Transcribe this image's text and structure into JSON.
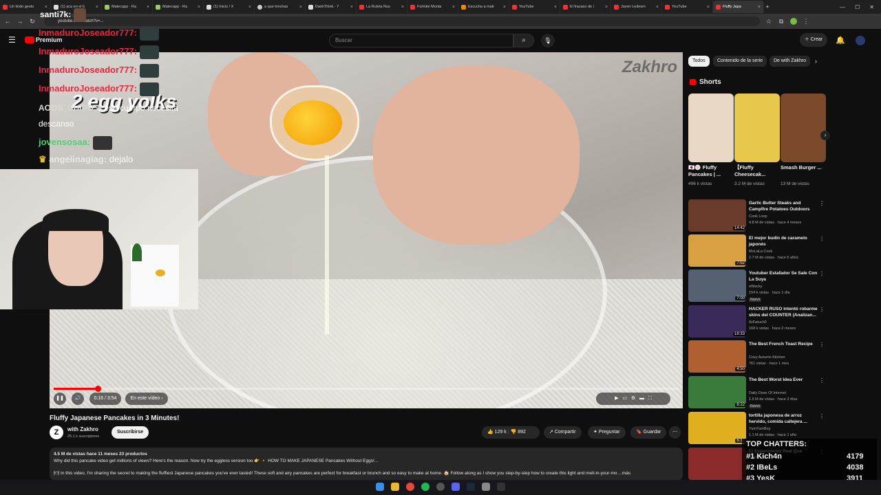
{
  "browser": {
    "tabs": [
      {
        "label": "Un lindo gesto"
      },
      {
        "label": "(1) aca en el b"
      },
      {
        "label": "Matecapp - Ra"
      },
      {
        "label": "Matecapp - Ra"
      },
      {
        "label": "(1) Inicio / X"
      },
      {
        "label": "a que hinchas"
      },
      {
        "label": "DankThink - 7"
      },
      {
        "label": "La Ruleta Rus"
      },
      {
        "label": "Fortnite Monta"
      },
      {
        "label": "Escucha a mati"
      },
      {
        "label": "YouTube"
      },
      {
        "label": "El fracaso de l"
      },
      {
        "label": "Javier Ledesm"
      },
      {
        "label": "YouTube"
      },
      {
        "label": "Fluffy Japa"
      }
    ],
    "url": "youtube.com/watch?v=..."
  },
  "youtube": {
    "premium_label": "Premium",
    "search_placeholder": "Buscar",
    "create_label": "Crear"
  },
  "video": {
    "watermark": "Zakhro",
    "overlay_text": "2 egg yolks",
    "time": "0:16 / 3:54",
    "chapter": "En este vídeo",
    "progress_fraction": 0.07,
    "title": "Fluffy Japanese Pancakes in 3 Minutes!",
    "channel": "with Zakhro",
    "subscribers": "25.1 k suscriptores",
    "subscribe_label": "Suscribirse",
    "likes": "129 k",
    "dislikes": "892",
    "share_label": "Compartir",
    "ask_label": "Preguntar",
    "save_label": "Guardar",
    "views_line": "4.5 M de vistas  hace 11 meses  23 productos",
    "desc_line1": "Why did this pancake video get millions of views? Here's the reason. Now try the eggless version too 👉 🔸 HOW TO MAKE JAPANESE Pancakes Without Eggs!...",
    "desc_line2": "🍽 In this video, I'm sharing the secret to making the fluffiest Japanese pancakes you've ever tasted! These soft and airy pancakes are perfect for breakfast or brunch and so easy to make at home. 🏠 Follow along as I show you step-by-step how to create this light and melt-in-your-mo ...más"
  },
  "chat": [
    {
      "user": "santi7k:",
      "text": ""
    },
    {
      "user": "InmaduroJoseador777:",
      "text": ""
    },
    {
      "user": "InmaduroJoseador777:",
      "text": ""
    },
    {
      "user": "InmaduroJoseador777:",
      "text": ""
    },
    {
      "user": "InmaduroJoseador777:",
      "text": ""
    },
    {
      "user": "AOOS_CHIPOS:",
      "text": "ese cuerpo necesita"
    },
    {
      "user": "",
      "text": "descanso"
    },
    {
      "user": "jovensosaa:",
      "text": ""
    },
    {
      "user": "angelinagiag:",
      "text": "dejalo"
    }
  ],
  "sidebar": {
    "chips": [
      "Todos",
      "Contenido de la serie",
      "De with Zakhro"
    ],
    "shorts_label": "Shorts",
    "shorts": [
      {
        "title": "🇯🇵🍥 Fluffy Pancakes | ...",
        "views": "496 k vistas",
        "color": "#e8d8c4"
      },
      {
        "title": "【Fluffy Cheesecak...",
        "views": "3.2 M de vistas",
        "color": "#e8c84a"
      },
      {
        "title": "Smash Burger ...",
        "views": "13 M de vistas",
        "color": "#7a4a2a"
      }
    ],
    "recommended": [
      {
        "title": "Garlic Butter Steaks and Campfire Potatoes Outdoors",
        "channel": "Cook Loop",
        "meta": "4.8 M de vistas · hace 4 meses",
        "duration": "14:42",
        "color": "#6a3a2a",
        "badge": ""
      },
      {
        "title": "El mejor budín de caramelo japonés",
        "channel": "MoLaLa Cook",
        "meta": "2.7 M de vistas · hace 5 años",
        "duration": "7:52",
        "color": "#d8a040",
        "badge": ""
      },
      {
        "title": "Youtuber Estafador Se Sale Con La Suya",
        "channel": "eWacky",
        "meta": "154 k vistas · hace 1 día",
        "duration": "7:00",
        "color": "#556070",
        "badge": "Nuevo"
      },
      {
        "title": "HACKER RUSO intentó robarme skins del COUNTER (Analizan...",
        "channel": "0xFatuch0",
        "meta": "168 k vistas · hace 2 meses",
        "duration": "18:33",
        "color": "#3a2a5a",
        "badge": ""
      },
      {
        "title": "The Best French Toast Recipe",
        "channel": "Cozy Autumn Kitchen",
        "meta": "761 vistas · hace 1 mes",
        "duration": "4:50",
        "color": "#b06030",
        "badge": ""
      },
      {
        "title": "The Best Worst Idea Ever",
        "channel": "Daily Dose Of Internet",
        "meta": "1.6 M de vistas · hace 3 días",
        "duration": "8:22",
        "color": "#3a7a3a",
        "badge": "Nuevo"
      },
      {
        "title": "tortilla japonesa de arroz hervido, comida callejera ...",
        "channel": "YumYumBoy",
        "meta": "1.1 M de vistas · hace 1 año",
        "duration": "6:31",
        "color": "#e0b020",
        "badge": ""
      },
      {
        "title": "El Experimento Real Que Terminó",
        "channel": "",
        "meta": "",
        "duration": "",
        "color": "#8a2a2a",
        "badge": ""
      }
    ]
  },
  "top_chatters": {
    "title": "TOP CHATTERS:",
    "rows": [
      {
        "rank": "#1",
        "name": "Kich4n",
        "count": "4179"
      },
      {
        "rank": "#2",
        "name": "IBeLs",
        "count": "4038"
      },
      {
        "rank": "#3",
        "name": "YesK",
        "count": "3911"
      }
    ]
  },
  "colors": {
    "accent": "#ff0000",
    "chat_name": "#e8283f",
    "chat_green": "#4fd06d"
  }
}
